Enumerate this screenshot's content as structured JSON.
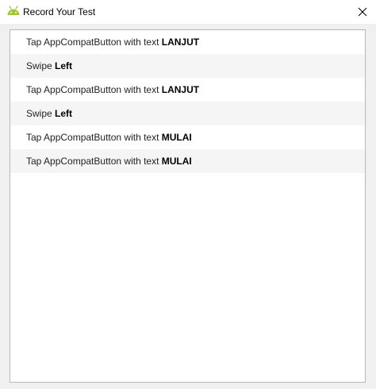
{
  "window": {
    "title": "Record Your Test",
    "app_icon": "android-icon",
    "close_icon": "close-icon"
  },
  "events": [
    {
      "prefix": "Tap AppCompatButton with text ",
      "target": "LANJUT"
    },
    {
      "prefix": "Swipe ",
      "target": "Left"
    },
    {
      "prefix": "Tap AppCompatButton with text ",
      "target": "LANJUT"
    },
    {
      "prefix": "Swipe ",
      "target": "Left"
    },
    {
      "prefix": "Tap AppCompatButton with text ",
      "target": "MULAI"
    },
    {
      "prefix": "Tap AppCompatButton with text ",
      "target": "MULAI"
    }
  ],
  "colors": {
    "android_green": "#a4c639",
    "alt_row": "#f5f5f5",
    "border": "#b8b8b8"
  }
}
